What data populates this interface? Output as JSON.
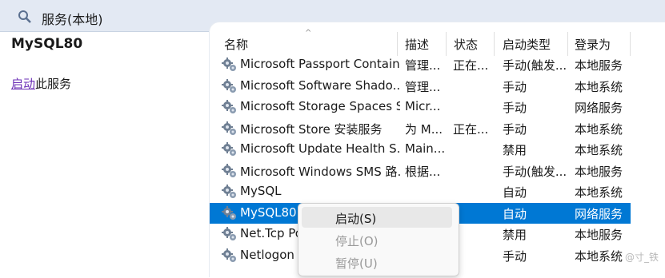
{
  "header": {
    "title": "服务(本地)",
    "icon": "services-icon"
  },
  "left": {
    "service_name": "MySQL80",
    "action_link": "启动",
    "action_suffix": "此服务"
  },
  "columns": {
    "name": "名称",
    "desc": "描述",
    "status": "状态",
    "startup": "启动类型",
    "logon": "登录为"
  },
  "rows": [
    {
      "name": "Microsoft Passport Container",
      "desc": "管理...",
      "status": "正在...",
      "startup": "手动(触发...",
      "logon": "本地服务"
    },
    {
      "name": "Microsoft Software Shado...",
      "desc": "管理...",
      "status": "",
      "startup": "手动",
      "logon": "本地系统"
    },
    {
      "name": "Microsoft Storage Spaces S...",
      "desc": "Micr...",
      "status": "",
      "startup": "手动",
      "logon": "网络服务"
    },
    {
      "name": "Microsoft Store 安装服务",
      "desc": "为 M...",
      "status": "正在...",
      "startup": "手动",
      "logon": "本地系统"
    },
    {
      "name": "Microsoft Update Health S...",
      "desc": "Main...",
      "status": "",
      "startup": "禁用",
      "logon": "本地系统"
    },
    {
      "name": "Microsoft Windows SMS 路...",
      "desc": "根据...",
      "status": "",
      "startup": "手动(触发...",
      "logon": "本地服务"
    },
    {
      "name": "MySQL",
      "desc": "",
      "status": "",
      "startup": "自动",
      "logon": "本地系统"
    },
    {
      "name": "MySQL80",
      "desc": "",
      "status": "",
      "startup": "自动",
      "logon": "网络服务"
    },
    {
      "name": "Net.Tcp Po",
      "desc": "",
      "status": "",
      "startup": "禁用",
      "logon": "本地服务"
    },
    {
      "name": "Netlogon",
      "desc": "",
      "status": "",
      "startup": "手动",
      "logon": "本地系统"
    }
  ],
  "context_menu": {
    "start": "启动(S)",
    "stop": "停止(O)",
    "pause": "暂停(U)"
  },
  "watermark": "@寸_铁",
  "colors": {
    "selection": "#0078d4",
    "header_bg": "#e3e9f3",
    "link": "#6a2db5"
  }
}
